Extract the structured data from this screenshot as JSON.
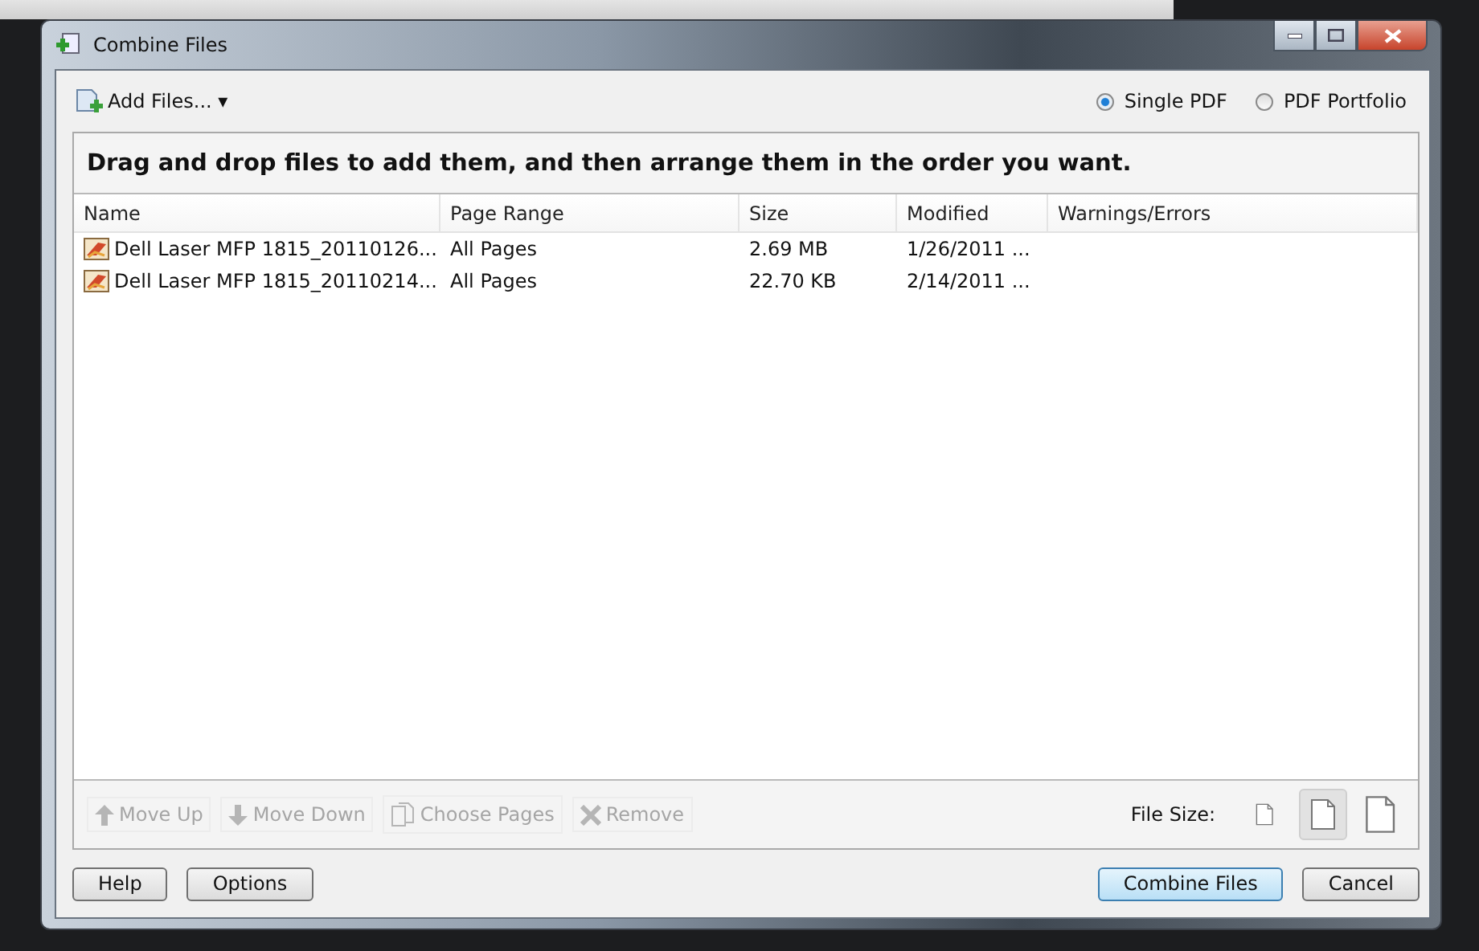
{
  "window": {
    "title": "Combine Files"
  },
  "toolbar": {
    "add_files": "Add Files...",
    "caret": "▾"
  },
  "output_modes": [
    {
      "label": "Single PDF",
      "selected": true
    },
    {
      "label": "PDF Portfolio",
      "selected": false
    }
  ],
  "instruction": "Drag and drop files to add them, and then arrange them in the order you want.",
  "table": {
    "columns": [
      "Name",
      "Page Range",
      "Size",
      "Modified",
      "Warnings/Errors"
    ],
    "rows": [
      {
        "name": "Dell Laser MFP 1815_20110126...",
        "page_range": "All Pages",
        "size": "2.69 MB",
        "modified": "1/26/2011 ..."
      },
      {
        "name": "Dell Laser MFP 1815_20110214...",
        "page_range": "All Pages",
        "size": "22.70 KB",
        "modified": "2/14/2011 ..."
      }
    ]
  },
  "actions": [
    {
      "kind": "up",
      "label": "Move Up",
      "disabled": true
    },
    {
      "kind": "down",
      "label": "Move Down",
      "disabled": true
    },
    {
      "kind": "pages",
      "label": "Choose Pages",
      "disabled": true
    },
    {
      "kind": "remove",
      "label": "Remove",
      "disabled": true
    }
  ],
  "file_size": {
    "label": "File Size:",
    "options": [
      {
        "kind": "small",
        "selected": false
      },
      {
        "kind": "medium",
        "selected": true
      },
      {
        "kind": "large",
        "selected": false
      }
    ]
  },
  "footer_left": [
    "Help",
    "Options"
  ],
  "footer_right": [
    {
      "label": "Combine Files",
      "default": true
    },
    {
      "label": "Cancel",
      "default": false
    }
  ]
}
